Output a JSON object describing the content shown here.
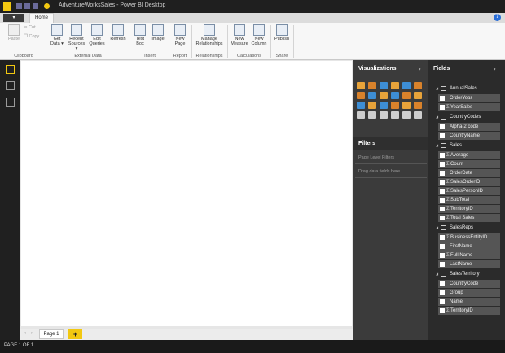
{
  "window": {
    "title": "AdventureWorksSales - Power BI Desktop"
  },
  "ribbon": {
    "file_tab": "▾",
    "home_tab": "Home",
    "groups": {
      "clipboard": "Clipboard",
      "external_data": "External Data",
      "insert": "Insert",
      "report": "Report",
      "relationships": "Relationships",
      "calculations": "Calculations",
      "share": "Share"
    },
    "buttons": {
      "paste": "Paste",
      "cut": "Cut",
      "copy": "Copy",
      "get_data": "Get Data ▾",
      "recent_sources": "Recent Sources ▾",
      "edit_queries": "Edit Queries",
      "refresh": "Refresh",
      "text_box": "Text Box",
      "image": "Image",
      "new_page": "New Page",
      "manage_relationships": "Manage Relationships",
      "new_measure": "New Measure",
      "new_column": "New Column",
      "publish": "Publish"
    }
  },
  "visualizations": {
    "header": "Visualizations"
  },
  "filters": {
    "header": "Filters",
    "page_level": "Page Level Filters",
    "drag_hint": "Drag data fields here"
  },
  "fields": {
    "header": "Fields",
    "tables": [
      {
        "name": "AnnualSales",
        "fields": [
          {
            "name": "OrderYear",
            "sigma": false
          },
          {
            "name": "YearSales",
            "sigma": true
          }
        ]
      },
      {
        "name": "CountryCodes",
        "fields": [
          {
            "name": "Alpha-2 code",
            "sigma": false
          },
          {
            "name": "CountryName",
            "sigma": false
          }
        ]
      },
      {
        "name": "Sales",
        "fields": [
          {
            "name": "Average",
            "sigma": true
          },
          {
            "name": "Count",
            "sigma": true
          },
          {
            "name": "OrderDate",
            "sigma": false
          },
          {
            "name": "SalesOrderID",
            "sigma": true
          },
          {
            "name": "SalesPersonID",
            "sigma": true
          },
          {
            "name": "SubTotal",
            "sigma": true
          },
          {
            "name": "TerritoryID",
            "sigma": true
          },
          {
            "name": "Total Sales",
            "sigma": true
          }
        ]
      },
      {
        "name": "SalesReps",
        "fields": [
          {
            "name": "BusinessEntityID",
            "sigma": true
          },
          {
            "name": "FirstName",
            "sigma": false
          },
          {
            "name": "Full Name",
            "sigma": true
          },
          {
            "name": "LastName",
            "sigma": false
          }
        ]
      },
      {
        "name": "SalesTerritory",
        "fields": [
          {
            "name": "CountryCode",
            "sigma": false
          },
          {
            "name": "Group",
            "sigma": false
          },
          {
            "name": "Name",
            "sigma": false
          },
          {
            "name": "TerritoryID",
            "sigma": true
          }
        ]
      }
    ]
  },
  "pages": {
    "tab": "Page 1",
    "add": "+"
  },
  "status": {
    "text": "PAGE 1 OF 1"
  },
  "colors": {
    "accent": "#f2c811",
    "pane_dark": "#3b3b3b",
    "field_bg": "#555555"
  }
}
